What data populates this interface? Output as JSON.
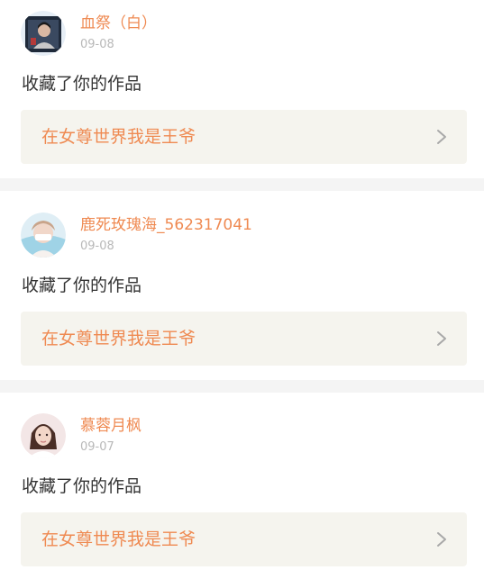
{
  "notifications": [
    {
      "username": "血祭（白）",
      "time": "09-08",
      "action": "收藏了你的作品",
      "work_title": "在女尊世界我是王爷",
      "avatar_icon": "user-avatar-icon"
    },
    {
      "username": "鹿死玫瑰海_562317041",
      "time": "09-08",
      "action": "收藏了你的作品",
      "work_title": "在女尊世界我是王爷",
      "avatar_icon": "user-avatar-icon"
    },
    {
      "username": "慕蓉月枫",
      "time": "09-07",
      "action": "收藏了你的作品",
      "work_title": "在女尊世界我是王爷",
      "avatar_icon": "user-avatar-icon"
    }
  ],
  "colors": {
    "accent": "#ef8a52",
    "text": "#333333",
    "muted": "#b8b8b8",
    "card_bg": "#f5f4ee",
    "page_bg": "#f4f4f4"
  },
  "icons": {
    "chevron": "chevron-right-icon"
  }
}
